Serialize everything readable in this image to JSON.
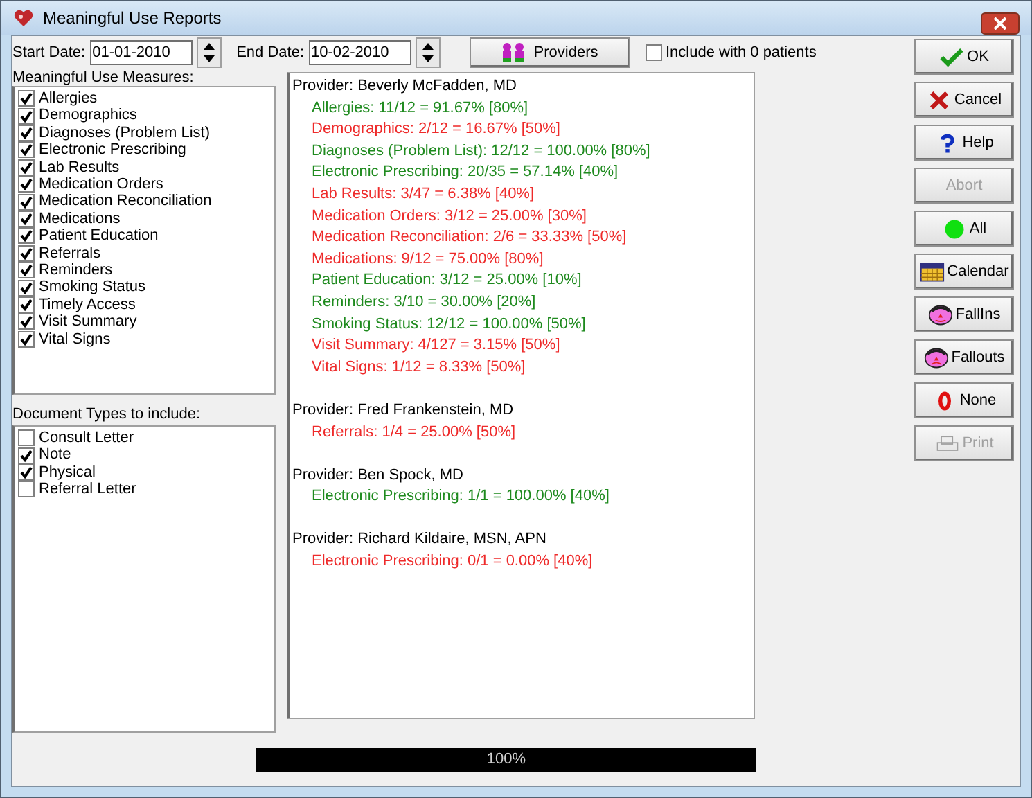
{
  "window": {
    "title": "Meaningful Use Reports"
  },
  "toolbar": {
    "start_date": {
      "label": "Start Date:",
      "value": "01-01-2010"
    },
    "end_date": {
      "label": "End Date:",
      "value": "10-02-2010"
    },
    "providers_button": "Providers",
    "include_zero": {
      "label": "Include with 0 patients",
      "checked": false
    }
  },
  "measures": {
    "label": "Meaningful Use Measures:",
    "items": [
      {
        "label": "Allergies",
        "checked": true
      },
      {
        "label": "Demographics",
        "checked": true
      },
      {
        "label": "Diagnoses (Problem List)",
        "checked": true
      },
      {
        "label": "Electronic Prescribing",
        "checked": true
      },
      {
        "label": "Lab Results",
        "checked": true
      },
      {
        "label": "Medication Orders",
        "checked": true
      },
      {
        "label": "Medication Reconciliation",
        "checked": true
      },
      {
        "label": "Medications",
        "checked": true
      },
      {
        "label": "Patient Education",
        "checked": true
      },
      {
        "label": "Referrals",
        "checked": true
      },
      {
        "label": "Reminders",
        "checked": true
      },
      {
        "label": "Smoking Status",
        "checked": true
      },
      {
        "label": "Timely Access",
        "checked": true
      },
      {
        "label": "Visit Summary",
        "checked": true
      },
      {
        "label": "Vital Signs",
        "checked": true
      }
    ]
  },
  "document_types": {
    "label": "Document Types to include:",
    "items": [
      {
        "label": "Consult Letter",
        "checked": false
      },
      {
        "label": "Note",
        "checked": true
      },
      {
        "label": "Physical",
        "checked": true
      },
      {
        "label": "Referral Letter",
        "checked": false
      }
    ]
  },
  "report": [
    {
      "provider": "Provider: Beverly McFadden, MD",
      "lines": [
        {
          "text": "Allergies:  11/12 = 91.67% [80%]",
          "met": true
        },
        {
          "text": "Demographics:  2/12 = 16.67% [50%]",
          "met": false
        },
        {
          "text": "Diagnoses (Problem List):  12/12 = 100.00% [80%]",
          "met": true
        },
        {
          "text": "Electronic Prescribing:  20/35 = 57.14% [40%]",
          "met": true
        },
        {
          "text": "Lab Results:  3/47 = 6.38% [40%]",
          "met": false
        },
        {
          "text": "Medication Orders:  3/12 = 25.00% [30%]",
          "met": false
        },
        {
          "text": "Medication Reconciliation:  2/6 = 33.33% [50%]",
          "met": false
        },
        {
          "text": "Medications:  9/12 = 75.00% [80%]",
          "met": false
        },
        {
          "text": "Patient Education:  3/12 = 25.00% [10%]",
          "met": true
        },
        {
          "text": "Reminders:  3/10 = 30.00% [20%]",
          "met": true
        },
        {
          "text": "Smoking Status:  12/12 = 100.00% [50%]",
          "met": true
        },
        {
          "text": "Visit Summary:  4/127 = 3.15% [50%]",
          "met": false
        },
        {
          "text": "Vital Signs:  1/12 = 8.33% [50%]",
          "met": false
        }
      ]
    },
    {
      "provider": "Provider: Fred Frankenstein, MD",
      "lines": [
        {
          "text": "Referrals:  1/4 = 25.00% [50%]",
          "met": false
        }
      ]
    },
    {
      "provider": "Provider: Ben Spock, MD",
      "lines": [
        {
          "text": "Electronic Prescribing:  1/1 = 100.00% [40%]",
          "met": true
        }
      ]
    },
    {
      "provider": "Provider: Richard Kildaire, MSN, APN",
      "lines": [
        {
          "text": "Electronic Prescribing:  0/1 = 0.00% [40%]",
          "met": false
        }
      ]
    }
  ],
  "buttons": [
    {
      "label": "OK",
      "kind": "ok",
      "disabled": false
    },
    {
      "label": "Cancel",
      "kind": "cancel",
      "disabled": false
    },
    {
      "label": "Help",
      "kind": "help",
      "disabled": false
    },
    {
      "label": "Abort",
      "kind": "none",
      "disabled": true
    },
    {
      "label": "All",
      "kind": "all",
      "disabled": false
    },
    {
      "label": "Calendar",
      "kind": "calendar",
      "disabled": false
    },
    {
      "label": "FallIns",
      "kind": "fallins",
      "disabled": false
    },
    {
      "label": "Fallouts",
      "kind": "fallouts",
      "disabled": false
    },
    {
      "label": "None",
      "kind": "zero",
      "disabled": false
    },
    {
      "label": "Print",
      "kind": "print",
      "disabled": true
    }
  ],
  "progress": {
    "level": 1,
    "text": "100%"
  }
}
